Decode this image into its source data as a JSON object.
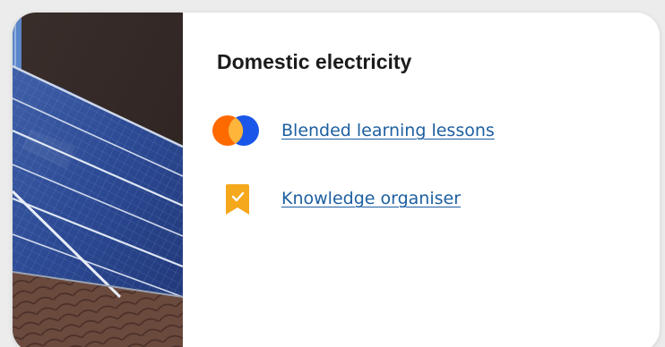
{
  "card": {
    "title": "Domestic electricity",
    "links": [
      {
        "label": "Blended learning lessons",
        "icon": "venn-circles-icon"
      },
      {
        "label": "Knowledge organiser",
        "icon": "bookmark-check-icon"
      }
    ]
  },
  "colors": {
    "link": "#1d5fa0",
    "title": "#1b1b1b",
    "venn_left": "#ff6a00",
    "venn_right": "#1a56e8",
    "venn_overlap": "#ffb43a",
    "bookmark": "#f5a81c"
  },
  "photo": {
    "subject": "solar panels on a tiled roof"
  }
}
